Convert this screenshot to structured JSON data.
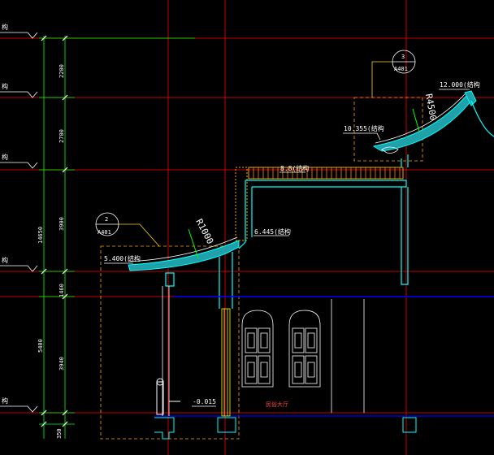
{
  "drawing": {
    "left_level_marks": [
      "构",
      "构",
      "构",
      "构",
      "构"
    ],
    "dimensions_outer": [
      "14650",
      "5400",
      "350"
    ],
    "dimensions_inner": [
      "2200",
      "2700",
      "3900",
      "1460",
      "3940",
      "350"
    ],
    "elevations": {
      "ridge": "12.000(结构",
      "upper_eave": "10.355(结构",
      "terrace": "8.8(结构",
      "wall_top": "6.445(结构",
      "lower_eave": "5.400(结构",
      "floor": "-0.015"
    },
    "radii": {
      "upper": "R4500",
      "lower": "R1000"
    },
    "detail_callouts": [
      {
        "number": "3",
        "sheet": "A401"
      },
      {
        "number": "2",
        "sheet": "A401"
      }
    ],
    "room_label": "民俗大厅"
  },
  "colors": {
    "background": "#000000",
    "grid_axis": "#ff0000",
    "dimension": "#00ff00",
    "structure": "#00ffff",
    "roof_fill": "#20a0a8",
    "detail_box": "#ffa500",
    "window": "#ffffff",
    "floor_line": "#0000ff",
    "leader": "#ffd700"
  }
}
